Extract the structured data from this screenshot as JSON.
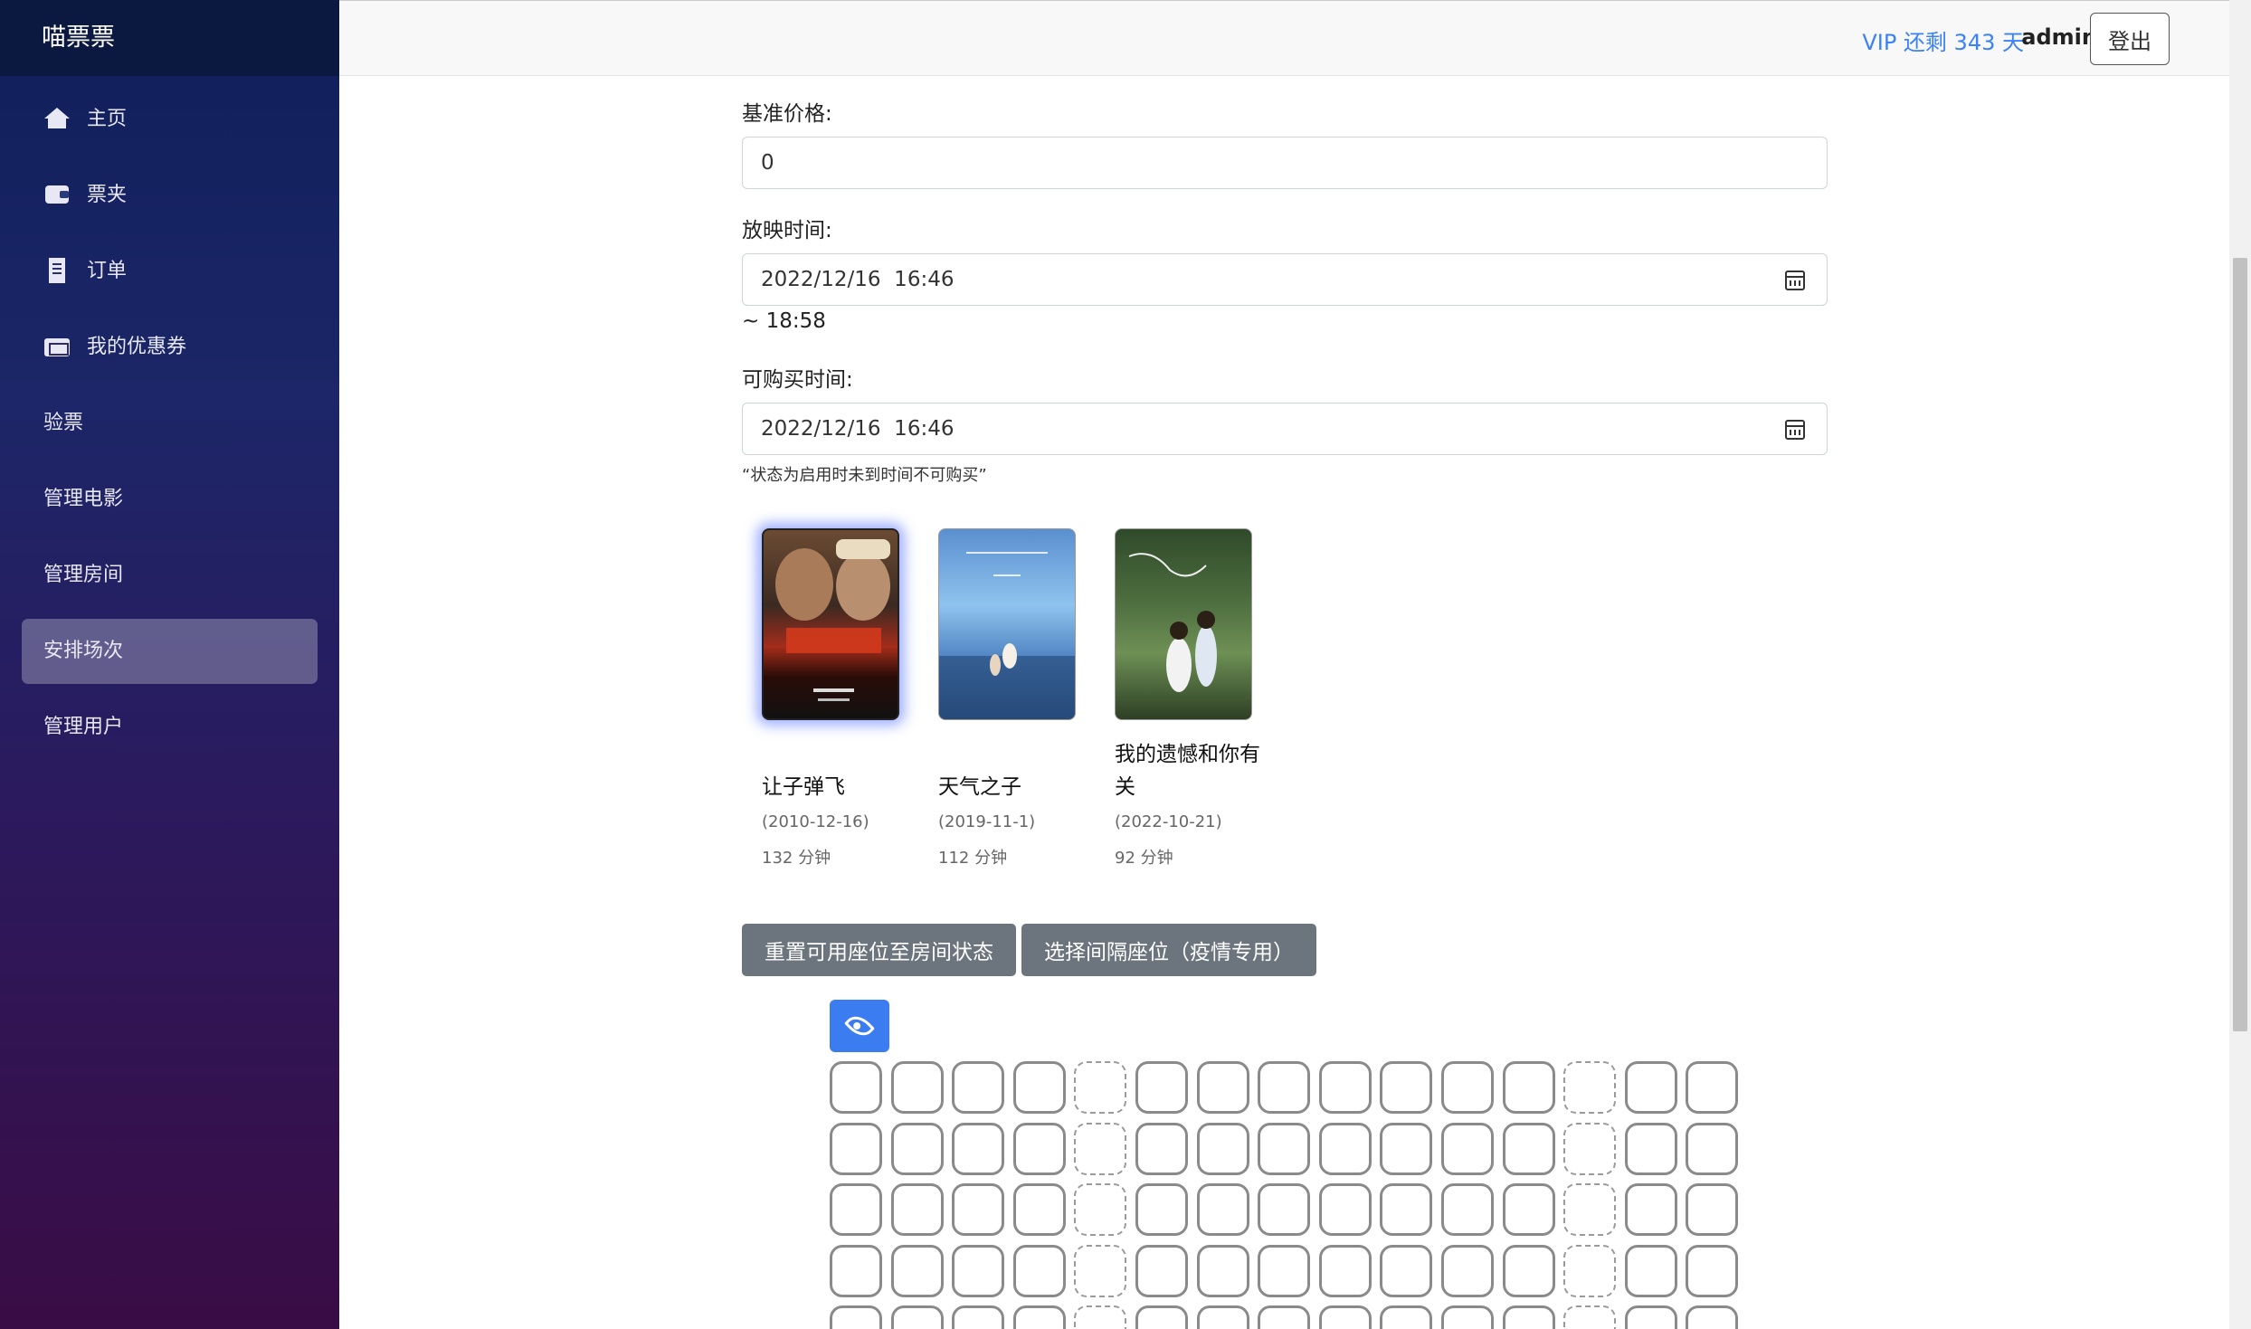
{
  "brand": "喵票票",
  "sidebar": {
    "items": [
      {
        "label": "主页",
        "icon": "home-icon"
      },
      {
        "label": "票夹",
        "icon": "wallet-icon"
      },
      {
        "label": "订单",
        "icon": "receipt-icon"
      },
      {
        "label": "我的优惠券",
        "icon": "ticket-icon"
      },
      {
        "label": "验票"
      },
      {
        "label": "管理电影"
      },
      {
        "label": "管理房间"
      },
      {
        "label": "安排场次",
        "active": true
      },
      {
        "label": "管理用户"
      }
    ]
  },
  "header": {
    "vip": "VIP 还剩 343 天",
    "user": "admin",
    "logout": "登出"
  },
  "form": {
    "base_price_label": "基准价格:",
    "base_price_value": "0",
    "show_time_label": "放映时间:",
    "show_time_value": "2022/12/16  16:46",
    "end_time": "~ 18:58",
    "buy_time_label": "可购买时间:",
    "buy_time_value": "2022/12/16  16:46",
    "buy_time_note": "“状态为启用时未到时间不可购买”"
  },
  "movies": [
    {
      "title": "让子弹飞",
      "date": "(2010-12-16)",
      "duration": "132 分钟",
      "selected": true
    },
    {
      "title": "天气之子",
      "date": "(2019-11-1)",
      "duration": "112 分钟",
      "selected": false
    },
    {
      "title": "我的遗憾和你有关",
      "date": "(2022-10-21)",
      "duration": "92 分钟",
      "selected": false
    }
  ],
  "buttons": {
    "reset_seats": "重置可用座位至房间状态",
    "select_spaced": "选择间隔座位（疫情专用）"
  },
  "seat_grid": {
    "visible_rows": 5,
    "columns": 15,
    "aisle_columns": [
      4,
      12
    ]
  },
  "colors": {
    "accent": "#3b82f6",
    "button_gray": "#6c757d",
    "eye_button": "#3b7cf0"
  }
}
